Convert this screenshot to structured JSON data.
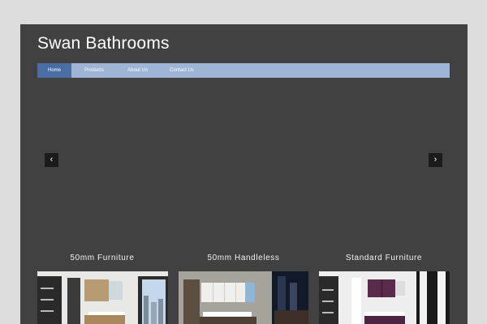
{
  "site": {
    "title": "Swan Bathrooms"
  },
  "nav": {
    "items": [
      {
        "label": "Home",
        "active": true
      },
      {
        "label": "Products",
        "active": false
      },
      {
        "label": "About Us",
        "active": false
      },
      {
        "label": "Contact Us",
        "active": false
      }
    ]
  },
  "slider": {
    "prev_icon": "chevron-left-icon",
    "next_icon": "chevron-right-icon",
    "prev_glyph": "‹",
    "next_glyph": "›"
  },
  "categories": [
    {
      "title": "50mm Furniture"
    },
    {
      "title": "50mm Handleless"
    },
    {
      "title": "Standard Furniture"
    }
  ],
  "colors": {
    "background": "#dcdcdc",
    "page": "#414141",
    "nav_bar": "#9fb5d6",
    "nav_active": "#4a6ea3"
  }
}
